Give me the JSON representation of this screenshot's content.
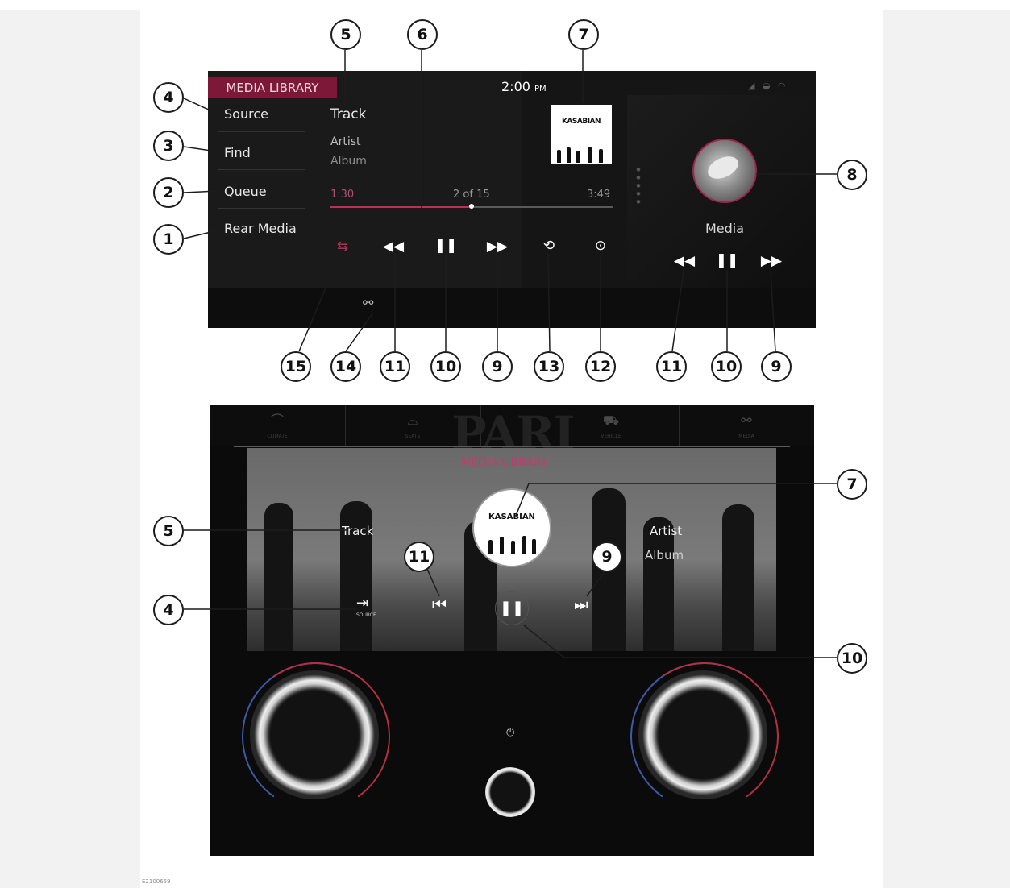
{
  "upper_screen": {
    "tab_title": "MEDIA LIBRARY",
    "clock": "2:00",
    "clock_suffix": "PM",
    "menu": [
      "Source",
      "Find",
      "Queue",
      "Rear Media"
    ],
    "track": "Track",
    "artist": "Artist",
    "album": "Album",
    "time_elapsed": "1:30",
    "track_count": "2 of 15",
    "time_total": "3:49",
    "progress_fraction": 0.5,
    "album_art_logo": "KASABIAN",
    "rear_label": "Media"
  },
  "lower_panel": {
    "title": "MEDIA LIBRARY",
    "track": "Track",
    "artist": "Artist",
    "album": "Album",
    "album_art_logo": "KASABIAN",
    "source_caption": "SOURCE",
    "header_logo": "PARI"
  },
  "icons": {
    "shuffle": "shuffle-icon",
    "rewind": "rewind-icon",
    "pause": "pause-icon",
    "fast_forward": "fast-forward-icon",
    "repeat": "repeat-icon",
    "play_next": "play-next-icon",
    "link": "link-icon",
    "skip_back": "skip-back-icon",
    "skip_forward": "skip-forward-icon",
    "source": "source-icon",
    "power": "power-icon"
  },
  "colors": {
    "accent": "#c02e5a",
    "tab_background": "#7d1838",
    "knob_blue": "#3c5aa8",
    "knob_red": "#b23040"
  },
  "callouts": {
    "c1": "1",
    "c2": "2",
    "c3": "3",
    "c4": "4",
    "c5": "5",
    "c6": "6",
    "c7": "7",
    "c8": "8",
    "c9": "9",
    "c10": "10",
    "c11": "11",
    "c12": "12",
    "c13": "13",
    "c14": "14",
    "c15": "15"
  },
  "figure_code": "E2100659"
}
